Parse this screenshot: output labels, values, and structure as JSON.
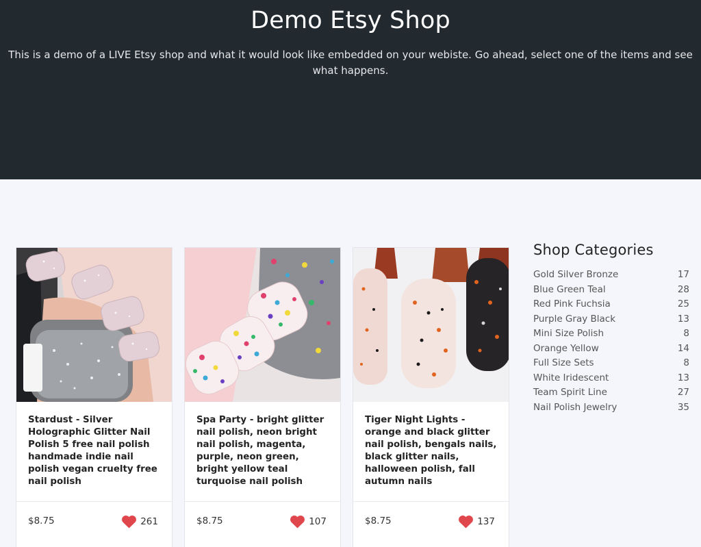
{
  "hero": {
    "title": "Demo Etsy Shop",
    "description": "This is a demo of a LIVE Etsy shop and what it would look like embedded on your webiste. Go ahead, select one of the items and see what happens."
  },
  "products": [
    {
      "title": "Stardust - Silver Holographic Glitter Nail Polish 5 free nail polish handmade indie nail polish vegan cruelty free nail polish",
      "price": "$8.75",
      "favorites": "261"
    },
    {
      "title": "Spa Party - bright glitter nail polish, neon bright nail polish, magenta, purple, neon green, bright yellow teal turquoise nail polish",
      "price": "$8.75",
      "favorites": "107"
    },
    {
      "title": "Tiger Night Lights - orange and black glitter nail polish, bengals nails, black glitter nails, halloween polish, fall autumn nails",
      "price": "$8.75",
      "favorites": "137"
    }
  ],
  "sidebar": {
    "title": "Shop Categories",
    "categories": [
      {
        "name": "Gold Silver Bronze",
        "count": "17"
      },
      {
        "name": "Blue Green Teal",
        "count": "28"
      },
      {
        "name": "Red Pink Fuchsia",
        "count": "25"
      },
      {
        "name": "Purple Gray Black",
        "count": "13"
      },
      {
        "name": "Mini Size Polish",
        "count": "8"
      },
      {
        "name": "Orange Yellow",
        "count": "14"
      },
      {
        "name": "Full Size Sets",
        "count": "8"
      },
      {
        "name": "White Iridescent",
        "count": "13"
      },
      {
        "name": "Team Spirit Line",
        "count": "27"
      },
      {
        "name": "Nail Polish Jewelry",
        "count": "35"
      }
    ]
  },
  "colors": {
    "hero_bg": "#22292f",
    "page_bg": "#f4f6fb",
    "heart": "#e0474c"
  }
}
